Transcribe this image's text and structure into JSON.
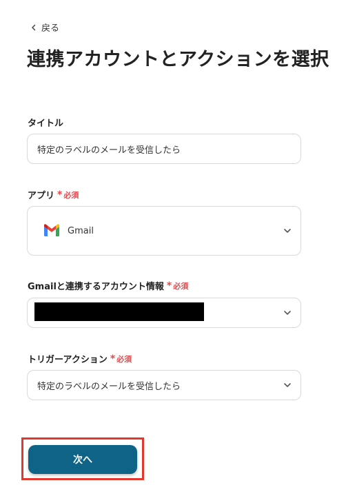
{
  "nav": {
    "back_label": "戻る"
  },
  "page_title": "連携アカウントとアクションを選択",
  "required_label": "必須",
  "fields": {
    "title": {
      "label": "タイトル",
      "value": "特定のラベルのメールを受信したら"
    },
    "app": {
      "label": "アプリ",
      "value": "Gmail"
    },
    "account": {
      "label": "Gmailと連携するアカウント情報",
      "value": ""
    },
    "trigger": {
      "label": "トリガーアクション",
      "value": "特定のラベルのメールを受信したら"
    }
  },
  "next_button_label": "次へ",
  "colors": {
    "primary": "#0f6386",
    "required": "#e5484d",
    "highlight": "#e2372e",
    "border": "#d6d9de"
  }
}
